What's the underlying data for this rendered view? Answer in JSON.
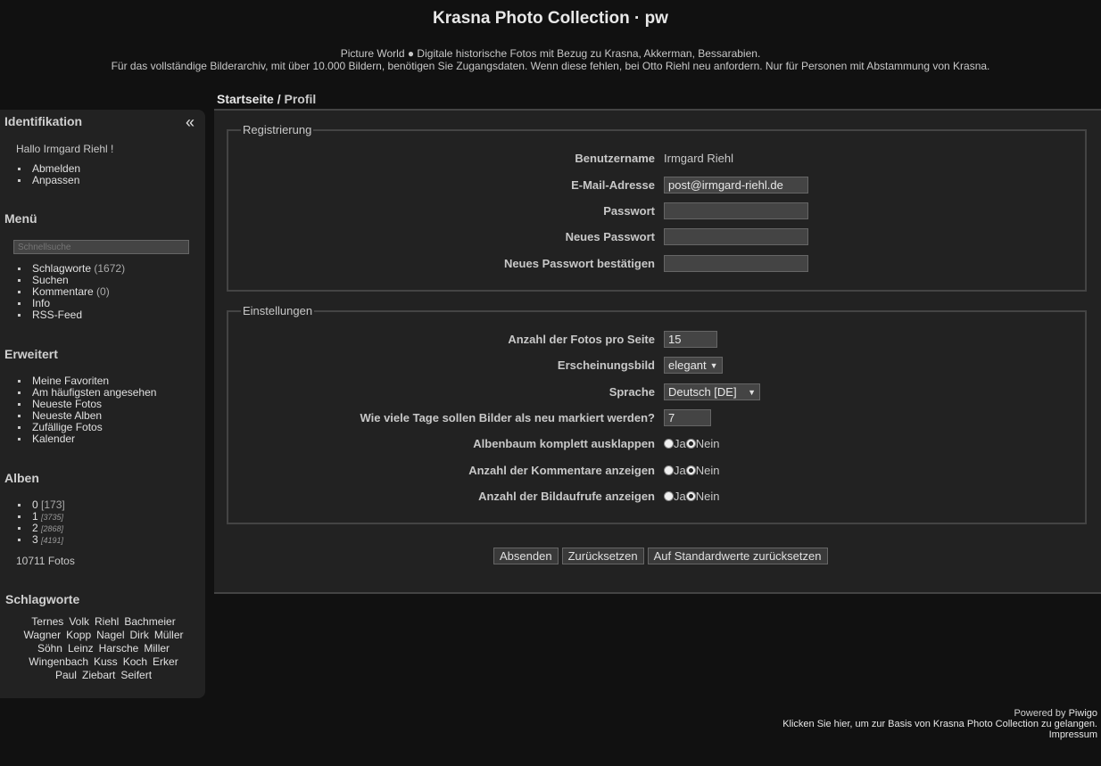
{
  "header": {
    "title": "Krasna Photo Collection · pw",
    "desc_line1": "Picture World ● Digitale historische Fotos mit Bezug zu Krasna, Akkerman, Bessarabien.",
    "desc_line2": "Für das vollständige Bilderarchiv, mit über 10.000 Bildern, benötigen Sie Zugangsdaten. Wenn diese fehlen, bei Otto Riehl neu anfordern. Nur für Personen mit Abstammung von Krasna."
  },
  "sidebar": {
    "collapse_glyph": "«",
    "identification": {
      "heading": "Identifikation",
      "greeting": "Hallo Irmgard Riehl !",
      "links": [
        "Abmelden",
        "Anpassen"
      ]
    },
    "menu": {
      "heading": "Menü",
      "search_placeholder": "Schnellsuche",
      "items": [
        {
          "label": "Schlagworte",
          "count": "(1672)"
        },
        {
          "label": "Suchen",
          "count": ""
        },
        {
          "label": "Kommentare",
          "count": "(0)"
        },
        {
          "label": "Info",
          "count": ""
        },
        {
          "label": "RSS-Feed",
          "count": ""
        }
      ]
    },
    "advanced": {
      "heading": "Erweitert",
      "items": [
        "Meine Favoriten",
        "Am häufigsten angesehen",
        "Neueste Fotos",
        "Neueste Alben",
        "Zufällige Fotos",
        "Kalender"
      ]
    },
    "albums": {
      "heading": "Alben",
      "items": [
        {
          "label": "0",
          "count": "[173]"
        },
        {
          "label": "1",
          "count": "[3735]"
        },
        {
          "label": "2",
          "count": "[2868]"
        },
        {
          "label": "3",
          "count": "[4191]"
        }
      ],
      "total": "10711 Fotos"
    },
    "tags": {
      "heading": "Schlagworte",
      "rows": [
        [
          "Ternes",
          "Volk",
          "Riehl",
          "Bachmeier"
        ],
        [
          "Wagner",
          "Kopp",
          "Nagel",
          "Dirk",
          "Müller"
        ],
        [
          "Söhn",
          "Leinz",
          "Harsche",
          "Miller"
        ],
        [
          "Wingenbach",
          "Kuss",
          "Koch",
          "Erker"
        ],
        [
          "Paul",
          "Ziebart",
          "Seifert"
        ]
      ]
    }
  },
  "breadcrumb": {
    "home": "Startseite",
    "separator": " / ",
    "current": "Profil"
  },
  "registration": {
    "legend": "Registrierung",
    "username_label": "Benutzername",
    "username_value": "Irmgard Riehl",
    "email_label": "E-Mail-Adresse",
    "email_value": "post@irmgard-riehl.de",
    "password_label": "Passwort",
    "new_password_label": "Neues Passwort",
    "confirm_password_label": "Neues Passwort bestätigen"
  },
  "settings": {
    "legend": "Einstellungen",
    "photos_per_page_label": "Anzahl der Fotos pro Seite",
    "photos_per_page_value": "15",
    "theme_label": "Erscheinungsbild",
    "theme_value": "elegant",
    "language_label": "Sprache",
    "language_value": "Deutsch [DE]",
    "new_days_label": "Wie viele Tage sollen Bilder als neu markiert werden?",
    "new_days_value": "7",
    "expand_label": "Albenbaum komplett ausklappen",
    "show_comments_label": "Anzahl der Kommentare anzeigen",
    "show_views_label": "Anzahl der Bildaufrufe anzeigen",
    "yes": "Ja",
    "no": "Nein"
  },
  "buttons": {
    "submit": "Absenden",
    "reset": "Zurücksetzen",
    "defaults": "Auf Standardwerte zurücksetzen"
  },
  "footer": {
    "powered_prefix": "Powered by ",
    "powered_link": "Piwigo",
    "home_link": "Klicken Sie hier, um zur Basis von Krasna Photo Collection zu gelangen.",
    "impressum": "Impressum"
  }
}
